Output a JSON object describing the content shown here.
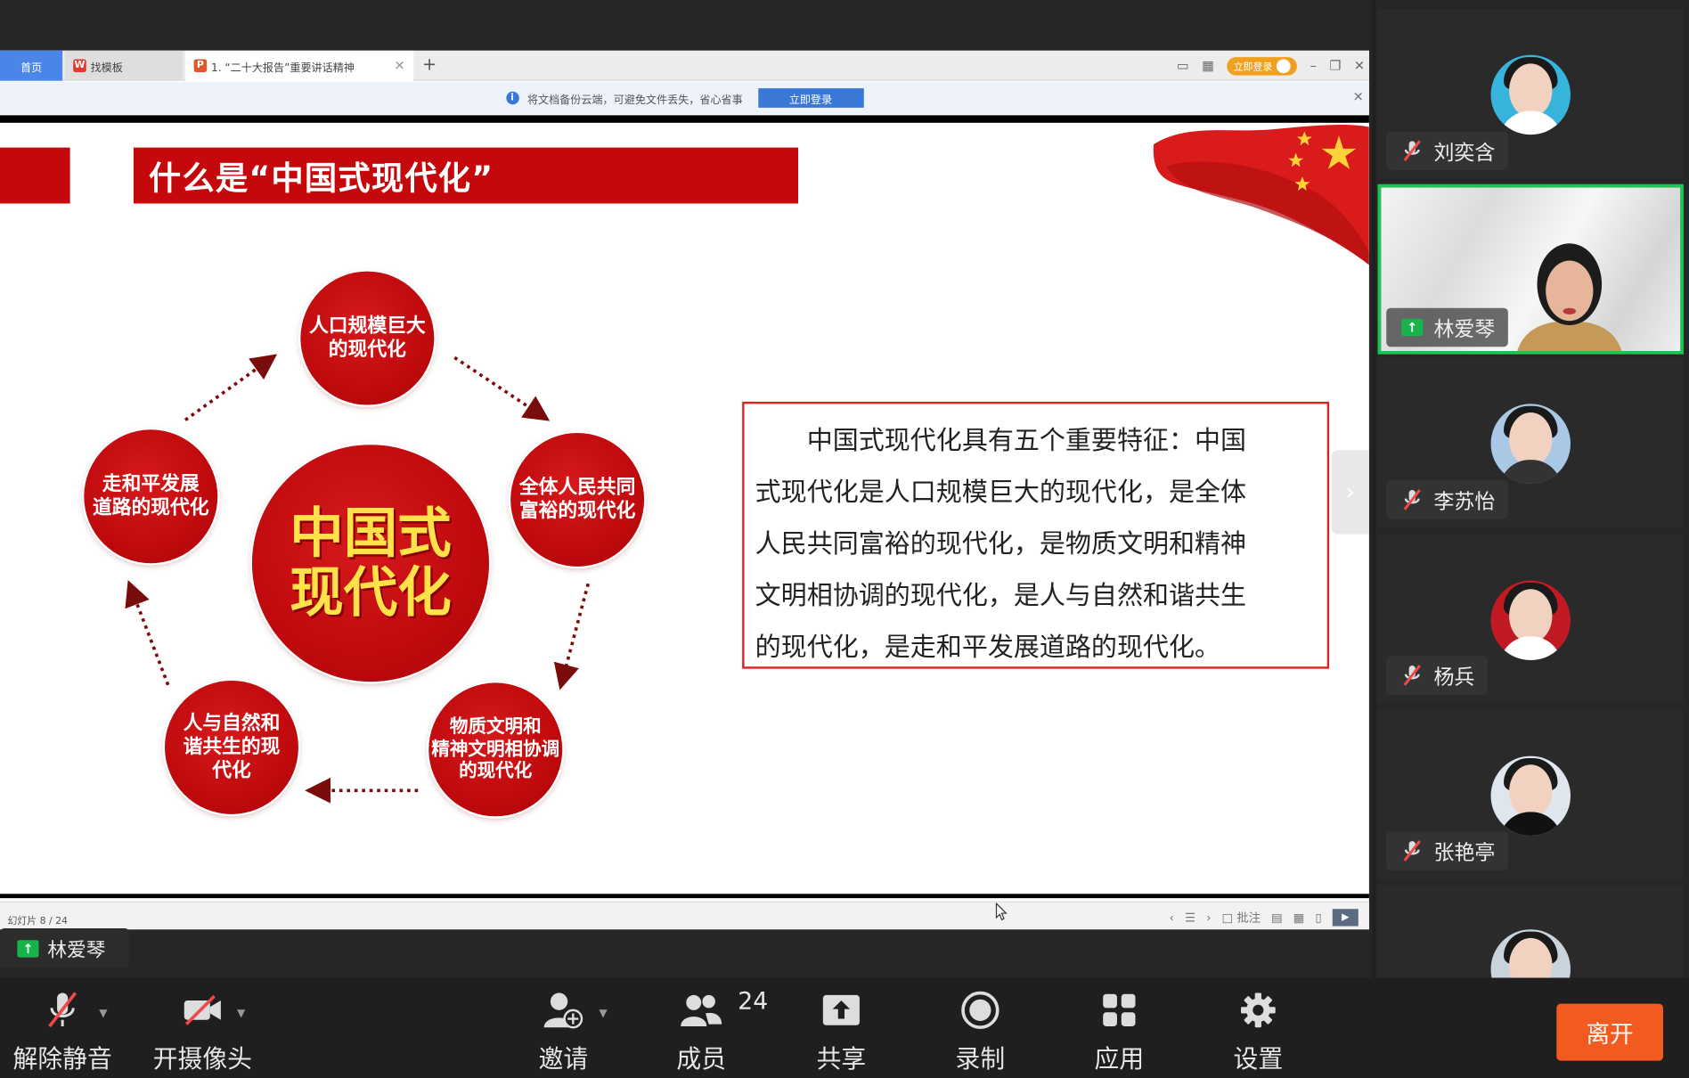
{
  "wps": {
    "tabs": {
      "home": "首页",
      "template": "找模板",
      "doc": "1. “二十大报告”重要讲话精神"
    },
    "login_pill": "立即登录",
    "notice_text": "将文档备份云端，可避免文件丢失，省心省事",
    "notice_button": "立即登录",
    "slide_counter": "幻灯片 8 / 24",
    "annotate_label": "批注"
  },
  "slide": {
    "title": "什么是“中国式现代化”",
    "center": [
      "中国式",
      "现代化"
    ],
    "nodes": {
      "top": [
        "人口规模巨大",
        "的现代化"
      ],
      "right": [
        "全体人民共同",
        "富裕的现代化"
      ],
      "bottom_right": [
        "物质文明和",
        "精神文明相协调",
        "的现代化"
      ],
      "bottom_left": [
        "人与自然和",
        "谐共生的现",
        "代化"
      ],
      "left": [
        "走和平发展",
        "道路的现代化"
      ]
    },
    "text_lines": [
      "　　中国式现代化具有五个重要特征：中国",
      "式现代化是人口规模巨大的现代化，是全体",
      "人民共同富裕的现代化，是物质文明和精神",
      "文明相协调的现代化，是人与自然和谐共生",
      "的现代化，是走和平发展道路的现代化。"
    ]
  },
  "speaker": "林爱琴",
  "participants": [
    {
      "name": "刘奕含",
      "muted": true,
      "avatar_bg": "#37b4dc"
    },
    {
      "name": "林爱琴",
      "sharing": true,
      "video": true
    },
    {
      "name": "李苏怡",
      "muted": true,
      "avatar_bg": "#a9c8e6"
    },
    {
      "name": "杨兵",
      "muted": true,
      "avatar_bg": "#c21a22"
    },
    {
      "name": "张艳亭",
      "muted": true,
      "avatar_bg": "#dfe6ee"
    }
  ],
  "toolbar": {
    "unmute": "解除静音",
    "camera": "开摄像头",
    "invite": "邀请",
    "members": "成员",
    "member_count": "24",
    "share": "共享",
    "record": "录制",
    "apps": "应用",
    "settings": "设置",
    "leave": "离开"
  },
  "colors": {
    "slide_red": "#c4080b",
    "center_text": "#ffe24a",
    "active_border": "#17c653",
    "leave_button": "#f25a1f"
  }
}
